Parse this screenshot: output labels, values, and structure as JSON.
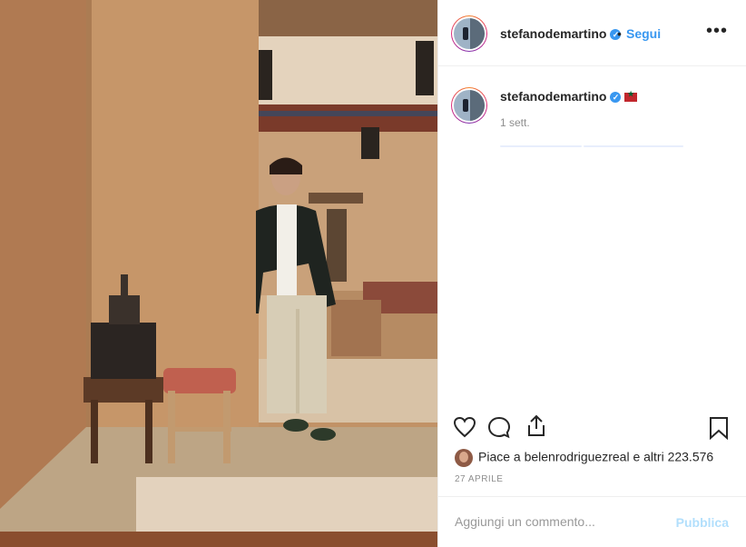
{
  "header": {
    "username": "stefanodemartino",
    "separator": "•",
    "follow_label": "Segui",
    "more_label": "•••"
  },
  "caption": {
    "username": "stefanodemartino",
    "flag_icon": "morocco-flag-icon",
    "time": "1 sett."
  },
  "actions": {
    "like_icon": "heart-icon",
    "comment_icon": "comment-icon",
    "share_icon": "share-icon",
    "save_icon": "bookmark-icon"
  },
  "likes": {
    "text": "Piace a belenrodriguezreal e altri 223.576"
  },
  "date": "27 APRILE",
  "comment": {
    "placeholder": "Aggiungi un commento...",
    "publish_label": "Pubblica"
  },
  "colors": {
    "accent": "#3897f0",
    "publish_disabled": "#b2dffc",
    "muted": "#8e8e8e"
  }
}
